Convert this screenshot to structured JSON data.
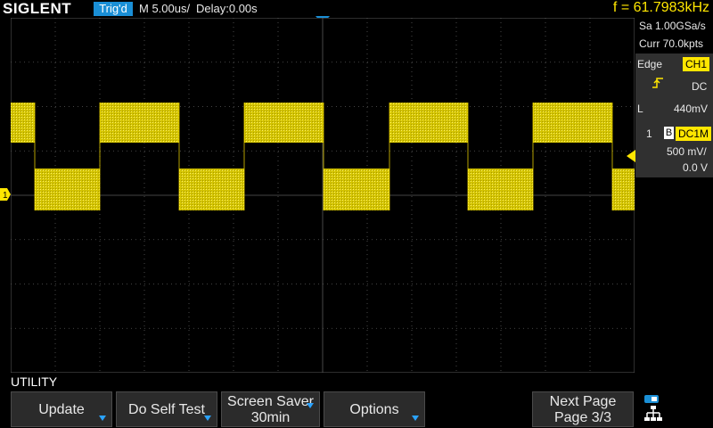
{
  "topbar": {
    "brand": "SIGLENT",
    "trigger_status": "Trig'd",
    "timebase": "M 5.00us/",
    "delay": "Delay:0.00s",
    "frequency": "f = 61.7983kHz"
  },
  "right_panel": {
    "sample_rate": "Sa 1.00GSa/s",
    "memory": "Curr 70.0kpts",
    "trigger": {
      "type": "Edge",
      "source": "CH1",
      "coupling": "DC",
      "level_label": "L",
      "level": "440mV"
    },
    "channel": {
      "number": "1",
      "bw_flag": "B",
      "coupling": "DC1M",
      "scale": "500 mV/",
      "offset": "0.0 V"
    }
  },
  "channel_marker": "1",
  "menu_title": "UTILITY",
  "softkeys": [
    {
      "label": "Update"
    },
    {
      "label": "Do Self Test"
    },
    {
      "label_line1": "Screen Saver",
      "label_line2": "30min"
    },
    {
      "label": "Options"
    },
    {
      "label_line1": "Next Page",
      "label_line2": "Page 3/3"
    }
  ],
  "colors": {
    "trace": "#ffe600",
    "accent": "#1a8fd6",
    "grid": "#5a5a5a"
  }
}
